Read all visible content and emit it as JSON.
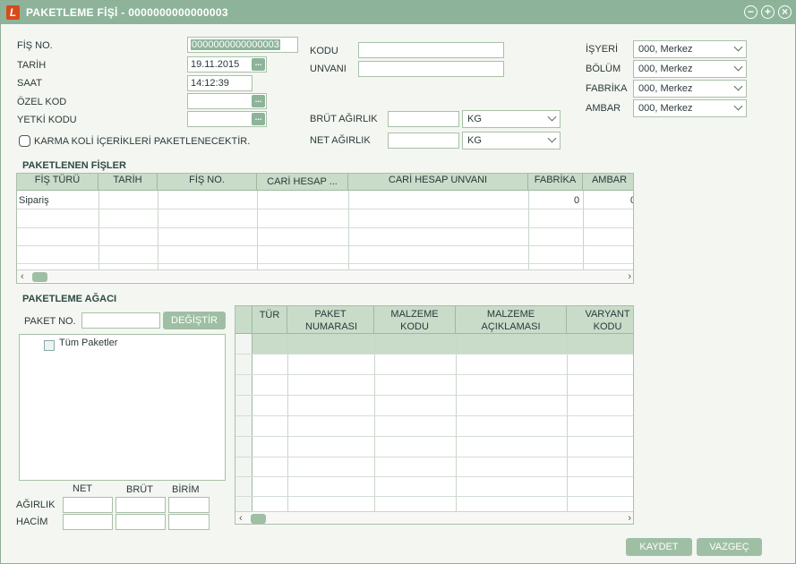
{
  "window": {
    "title": "PAKETLEME FİŞİ - 0000000000000003",
    "app_icon": "L"
  },
  "header": {
    "fis_no_label": "FİŞ NO.",
    "fis_no_value": "0000000000000003",
    "tarih_label": "TARİH",
    "tarih_value": "19.11.2015",
    "saat_label": "SAAT",
    "saat_value": "14:12:39",
    "ozel_kod_label": "ÖZEL KOD",
    "ozel_kod_value": "",
    "yetki_kodu_label": "YETKİ KODU",
    "yetki_kodu_value": "",
    "karma_label": "KARMA KOLİ İÇERİKLERİ PAKETLENECEKTİR.",
    "kodu_label": "KODU",
    "kodu_value": "",
    "unvani_label": "UNVANI",
    "unvani_value": "",
    "brut_label": "BRÜT AĞIRLIK",
    "brut_value": "",
    "brut_unit": "KG",
    "net_label": "NET AĞIRLIK",
    "net_value": "",
    "net_unit": "KG",
    "isyeri_label": "İŞYERİ",
    "isyeri_value": "000, Merkez",
    "bolum_label": "BÖLÜM",
    "bolum_value": "000, Merkez",
    "fabrika_label": "FABRİKA",
    "fabrika_value": "000, Merkez",
    "ambar_label": "AMBAR",
    "ambar_value": "000, Merkez"
  },
  "paketlenen": {
    "title": "PAKETLENEN FİŞLER",
    "columns": [
      "FİŞ TÜRÜ",
      "TARİH",
      "FİŞ NO.",
      "CARİ HESAP ...",
      "CARİ HESAP UNVANI",
      "FABRİKA",
      "AMBAR"
    ],
    "rows": [
      [
        "Sipariş",
        "",
        "",
        "",
        "",
        "0",
        "0"
      ]
    ]
  },
  "agac": {
    "title": "PAKETLEME AĞACI",
    "paket_no_label": "PAKET NO.",
    "paket_no_value": "",
    "degistir_label": "DEĞİŞTİR",
    "tree_root": "Tüm Paketler",
    "net_label": "NET",
    "brut_label": "BRÜT",
    "birim_label": "BİRİM",
    "agirlik_label": "AĞIRLIK",
    "hacim_label": "HACİM"
  },
  "detail_grid": {
    "columns": [
      "TÜR",
      "PAKET NUMARASI",
      "MALZEME KODU",
      "MALZEME AÇIKLAMASI",
      "VARYANT KODU"
    ]
  },
  "footer": {
    "kaydet_label": "KAYDET",
    "vazgec_label": "VAZGEÇ"
  }
}
